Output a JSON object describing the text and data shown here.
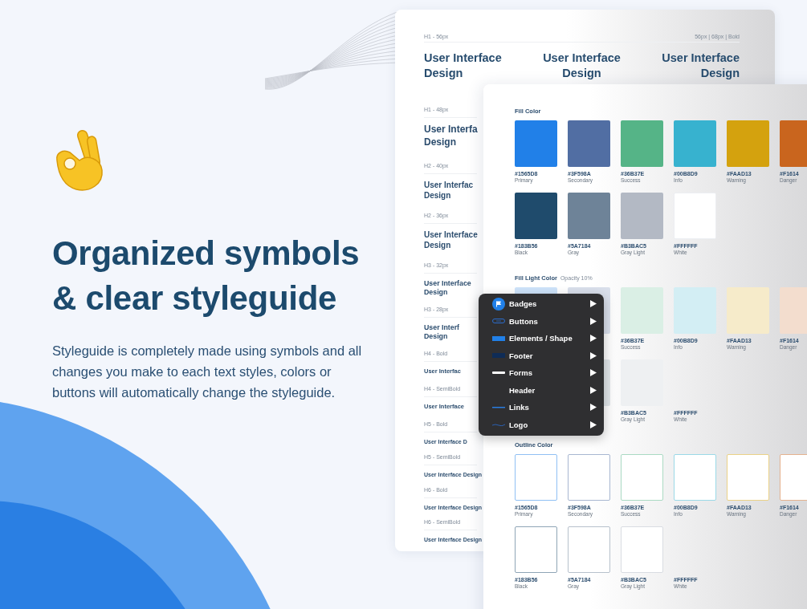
{
  "hero": {
    "heading": "Organized symbols & clear styleguide",
    "text": "Styleguide is completely made using symbols and all changes you make to each text styles, colors or buttons will automatically change the styleguide."
  },
  "typography": {
    "label": "H1 - 56px",
    "spec": "56px | 68px | Bold",
    "samples": [
      "User Interface\nDesign",
      "User Interface\nDesign",
      "User Interface\nDesign"
    ],
    "sections": [
      {
        "kind": "h1",
        "label": "H1 - 48px",
        "sample": "User Interfa\nDesign"
      },
      {
        "kind": "h2",
        "label": "H2 - 40px",
        "sample": "User Interfac\nDesign"
      },
      {
        "kind": "h2",
        "label": "H2 - 36px",
        "sample": "User Interface\nDesign"
      },
      {
        "kind": "h3",
        "label": "H3 - 32px",
        "sample": "User Interface\nDesign"
      },
      {
        "kind": "h3",
        "label": "H3 - 28px",
        "sample": "User Interf\nDesign"
      },
      {
        "kind": "h4",
        "label": "H4 - Bold",
        "sample": "User Interfac"
      },
      {
        "kind": "h4",
        "label": "H4 - SemiBold",
        "sample": "User Interface"
      },
      {
        "kind": "h5",
        "label": "H5 - Bold",
        "sample": "User Interface D"
      },
      {
        "kind": "h5",
        "label": "H5 - SemiBold",
        "sample": "User Interface Design"
      },
      {
        "kind": "h6",
        "label": "H6 - Bold",
        "sample": "User Interface Design"
      },
      {
        "kind": "h6",
        "label": "H6 - SemiBold",
        "sample": "User Interface Design"
      }
    ]
  },
  "styleguide": {
    "sections": [
      {
        "kind": "fill",
        "title": "Fill Color",
        "rows": [
          [
            {
              "color": "#2180e8",
              "hex": "#1565D8",
              "name": "Primary"
            },
            {
              "color": "#516ea3",
              "hex": "#3F598A",
              "name": "Secondary"
            },
            {
              "color": "#55b487",
              "hex": "#36B37E",
              "name": "Success"
            },
            {
              "color": "#37b2cf",
              "hex": "#00B8D9",
              "name": "Info"
            },
            {
              "color": "#d4a20e",
              "hex": "#FAAD13",
              "name": "Warning"
            },
            {
              "color": "#c9651e",
              "hex": "#F1614",
              "name": "Danger"
            }
          ],
          [
            {
              "color": "#1f4b6c",
              "hex": "#183B56",
              "name": "Black"
            },
            {
              "color": "#6e8398",
              "hex": "#5A7184",
              "name": "Gray"
            },
            {
              "color": "#b3b9c4",
              "hex": "#B3BAC5",
              "name": "Gray Light"
            },
            {
              "color": "#ffffff",
              "hex": "#FFFFFF",
              "name": "White"
            }
          ]
        ]
      },
      {
        "kind": "light",
        "title": "Fill Light Color",
        "note": "Opacity 10%",
        "rows": [
          [
            {},
            {},
            {
              "hex": "#36B37E",
              "name": "Success"
            },
            {
              "hex": "#00B8D9",
              "name": "Info"
            },
            {
              "hex": "#FAAD13",
              "name": "Warning"
            },
            {
              "hex": "#F1614",
              "name": "Danger"
            }
          ],
          [
            {},
            {},
            {
              "hex": "#B3BAC5",
              "name": "Gray Light"
            },
            {
              "hex": "#FFFFFF",
              "name": "White"
            }
          ]
        ]
      },
      {
        "kind": "outline",
        "title": "Outline Color",
        "rows": [
          [
            {
              "hex": "#1565D8",
              "name": "Primary"
            },
            {
              "hex": "#3F598A",
              "name": "Secondary"
            },
            {
              "hex": "#36B37E",
              "name": "Success"
            },
            {
              "hex": "#00B8D9",
              "name": "Info"
            },
            {
              "hex": "#FAAD13",
              "name": "Warning"
            },
            {
              "hex": "#F1614",
              "name": "Danger"
            }
          ],
          [
            {
              "hex": "#183B56",
              "name": "Black"
            },
            {
              "hex": "#5A7184",
              "name": "Gray"
            },
            {
              "hex": "#B3BAC5",
              "name": "Gray Light"
            },
            {
              "hex": "#FFFFFF",
              "name": "White"
            }
          ]
        ]
      }
    ]
  },
  "menu": {
    "items": [
      {
        "label": "Badges"
      },
      {
        "label": "Buttons"
      },
      {
        "label": "Elements / Shape"
      },
      {
        "label": "Footer"
      },
      {
        "label": "Forms"
      },
      {
        "label": "Header"
      },
      {
        "label": "Links"
      },
      {
        "label": "Logo"
      }
    ]
  }
}
